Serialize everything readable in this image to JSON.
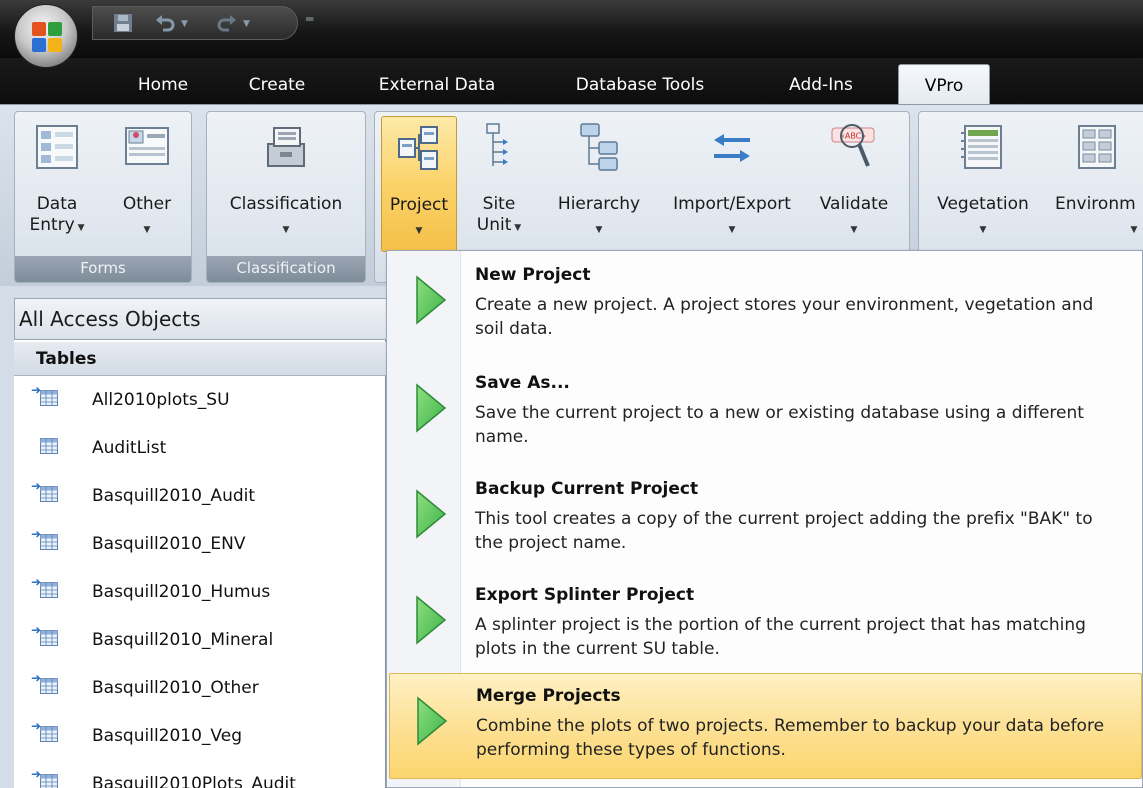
{
  "tabs": [
    {
      "label": "Home"
    },
    {
      "label": "Create"
    },
    {
      "label": "External Data"
    },
    {
      "label": "Database Tools"
    },
    {
      "label": "Add-Ins"
    },
    {
      "label": "VPro"
    }
  ],
  "ribbon": {
    "forms_group": {
      "label": "Forms",
      "buttons": [
        {
          "line1": "Data",
          "line2": "Entry"
        },
        {
          "line1": "Other"
        }
      ]
    },
    "classification_group": {
      "label": "Classification",
      "buttons": [
        {
          "line1": "Classification"
        }
      ]
    },
    "vpro_buttons": [
      {
        "line1": "Project"
      },
      {
        "line1": "Site",
        "line2": "Unit"
      },
      {
        "line1": "Hierarchy"
      },
      {
        "line1": "Import/Export"
      },
      {
        "line1": "Validate"
      }
    ],
    "data_buttons": [
      {
        "line1": "Vegetation"
      },
      {
        "line1": "Environm"
      }
    ],
    "validate_icon_text": "«ABC»"
  },
  "nav": {
    "header": "All Access Objects",
    "section": "Tables",
    "items": [
      {
        "name": "All2010plots_SU",
        "linked": true
      },
      {
        "name": "AuditList",
        "linked": false
      },
      {
        "name": "Basquill2010_Audit",
        "linked": true
      },
      {
        "name": "Basquill2010_ENV",
        "linked": true
      },
      {
        "name": "Basquill2010_Humus",
        "linked": true
      },
      {
        "name": "Basquill2010_Mineral",
        "linked": true
      },
      {
        "name": "Basquill2010_Other",
        "linked": true
      },
      {
        "name": "Basquill2010_Veg",
        "linked": true
      },
      {
        "name": "Basquill2010Plots_Audit",
        "linked": true
      }
    ]
  },
  "menu": {
    "items": [
      {
        "title": "New Project",
        "description": "Create a new project.  A project stores your environment, vegetation and soil data."
      },
      {
        "title": "Save As...",
        "description": "Save the current project to a new or existing database using a different name."
      },
      {
        "title": "Backup Current Project",
        "description": "This tool creates a copy of the current project adding the prefix \"BAK\" to the project name."
      },
      {
        "title": "Export Splinter Project",
        "description": "A splinter project is the portion of the current project that has matching plots in the current SU table."
      },
      {
        "title": "Merge Projects",
        "description": "Combine the plots of two projects.  Remember to backup your data before performing these types of functions.",
        "highlighted": true
      }
    ]
  },
  "colors": {
    "accent": "#fbd36a",
    "play_green": "#3cb24a",
    "link_blue": "#2b6fc2"
  }
}
